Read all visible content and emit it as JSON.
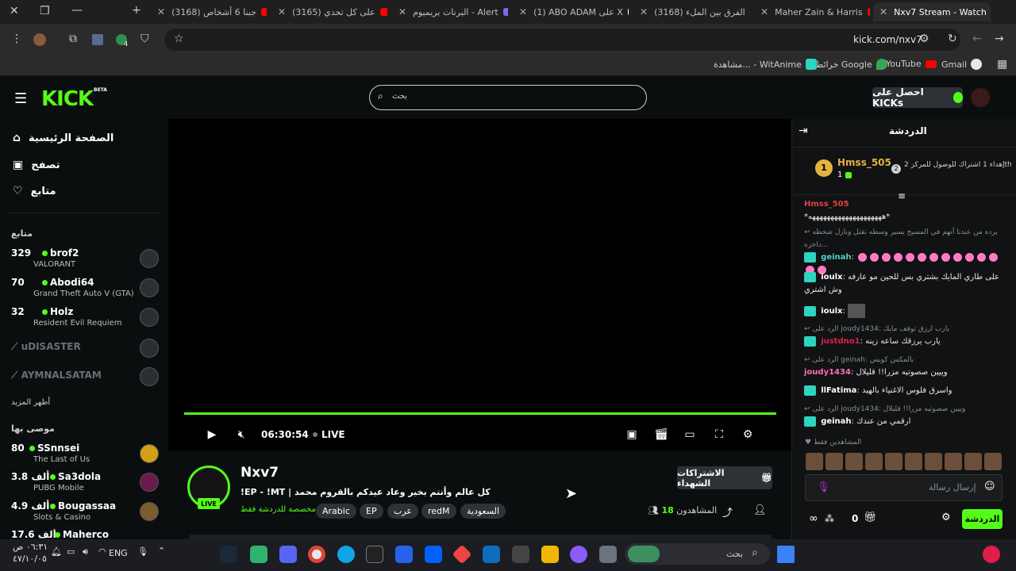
{
  "browser": {
    "tabs": [
      {
        "title": "(3168) جبنا 6 أشخاص",
        "color": "#ff0000"
      },
      {
        "title": "(3165) على كل تحدي",
        "color": "#ff0000"
      },
      {
        "title": "البرنات بريميوم - Alert",
        "color": "#7b68ee"
      },
      {
        "title": "(1) ABO ADAM على X",
        "color": "#ffffff"
      },
      {
        "title": "(3168) الفرق بين الملء",
        "color": "#ff0000"
      },
      {
        "title": "Maher Zain & Harris",
        "color": "#ff0000"
      },
      {
        "title": "Nxv7 Stream - Watch",
        "color": "#53fc18"
      }
    ],
    "url": "kick.com/nxv7",
    "bookmarks": [
      {
        "label": "Gmail"
      },
      {
        "label": "YouTube"
      },
      {
        "label": "خرائط Google"
      },
      {
        "label": "مشاهدة... - WitAnime"
      }
    ],
    "extension_badge": "4"
  },
  "kick": {
    "logo": "KICK",
    "beta": "BETA",
    "search_placeholder": "بحث",
    "get_kicks": "احصل على KICKs"
  },
  "sidebar": {
    "nav": [
      {
        "label": "الصفحة الرئيسية"
      },
      {
        "label": "تصفح"
      },
      {
        "label": "متابع"
      }
    ],
    "following_label": "متابع",
    "following": [
      {
        "count": "329",
        "name": "brof2",
        "game": "VALORANT"
      },
      {
        "count": "70",
        "name": "Abodi64",
        "game": "Grand Theft Auto V (GTA)"
      },
      {
        "count": "32",
        "name": "Holz",
        "game": "Resident Evil Requiem"
      }
    ],
    "offline": [
      "uDISASTER",
      "AYMNALSATAM"
    ],
    "show_more": "أظهر المزيد",
    "recommended_label": "موصى بها",
    "recommended": [
      {
        "count": "80",
        "name": "SSnnsei",
        "game": "The Last of Us"
      },
      {
        "count": "3.8 ألف",
        "name": "Sa3dola",
        "game": "PUBG Mobile"
      },
      {
        "count": "4.9 ألف",
        "name": "Bougassaa",
        "game": "Slots & Casino"
      },
      {
        "count": "17.6 ألف",
        "name": "Maherco",
        "game": ""
      }
    ]
  },
  "player": {
    "time": "06:30:54",
    "live": "LIVE"
  },
  "channel": {
    "name": "Nxv7",
    "title": "!EP - !MT | كل عالم وأنتم بخير وعاد عيدكم بالقروم محمد",
    "restriction": "مخصصة للدردشة فقط",
    "tags": [
      "Arabic",
      "EP",
      "عرب",
      "redM",
      "السعودية"
    ],
    "live_badge": "LIVE",
    "gift_subs": "الاشتراكات الشهداء",
    "viewers_label": "المشاهدون",
    "viewers_count": "18"
  },
  "chat": {
    "title": "الدردشة",
    "gift": {
      "rank": "1",
      "user": "Hmss_505",
      "count": "1",
      "note": "إهداء 1 اشتراك للوصول للمركز 2th",
      "place": "2"
    },
    "messages": [
      {
        "user": "Hmss_505",
        "text": "*ههههههههههههههههههههه*",
        "reply": ""
      },
      {
        "user": "geinah",
        "text": "",
        "reply": "يرده من عندنا أنهم في المسيح بسير وسطه تقتل ونازل شخطه داخره..."
      },
      {
        "user": "ioulx",
        "text": "على طاري المايك بشتري بس للحين مو عارفه وش اشتري",
        "reply": ""
      },
      {
        "user": "ioulx",
        "text": "",
        "reply": ""
      },
      {
        "user": "justdno1",
        "text": "يارب يرزقك ساعه زينه",
        "reply": "الرد على joudy1434: يارب ارزق توقف مايك"
      },
      {
        "user": "joudy1434",
        "text": "وييين صصوتيه مزرا!! قليلال",
        "reply": "الرد على geinah: بالمكس كويس"
      },
      {
        "user": "llFatima",
        "text": "واسرق فلوس الاغنياء بالهيد",
        "reply": ""
      },
      {
        "user": "geinah",
        "text": "ارقمي من عندك",
        "reply": "الرد على joudy1434: وييين صصوتيه مزرا!! قليلال"
      }
    ],
    "viewers_caption": "المشاهدين فقط",
    "input_placeholder": "إرسال رسالة",
    "kicks_count": "0",
    "send": "الدردشة"
  },
  "taskbar": {
    "search": "بحث",
    "lang": "ENG",
    "time": "٠٦:٣١ ص",
    "date": "٤٧/١٠/٠٥"
  }
}
